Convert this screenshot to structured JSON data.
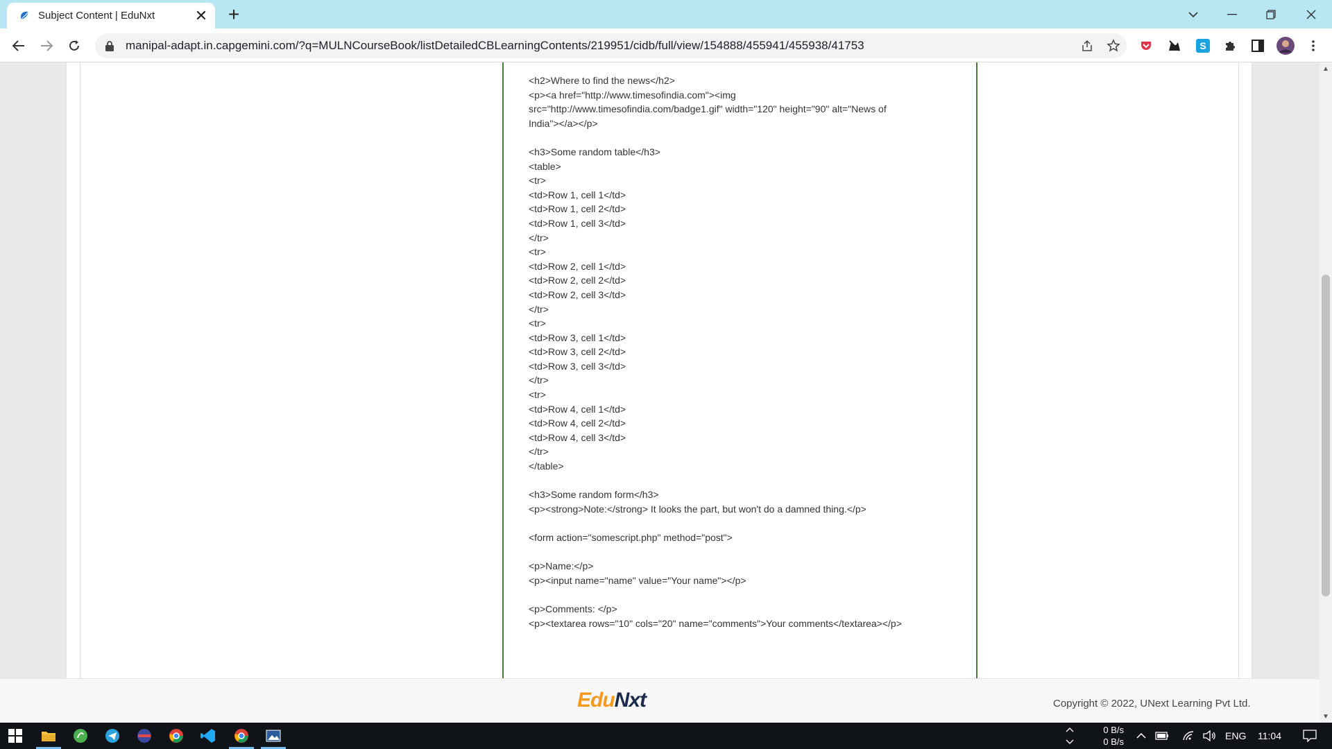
{
  "browser": {
    "tab_title": "Subject Content | EduNxt",
    "url": "manipal-adapt.in.capgemini.com/?q=MULNCourseBook/listDetailedCBLearningContents/219951/cidb/full/view/154888/455941/455938/41753"
  },
  "content": {
    "code_text": "<h2>Where to find the news</h2>\n<p><a href=\"http://www.timesofindia.com\"><img\nsrc=\"http://www.timesofindia.com/badge1.gif\" width=\"120\" height=\"90\" alt=\"News of\nIndia\"></a></p>\n\n<h3>Some random table</h3>\n<table>\n<tr>\n<td>Row 1, cell 1</td>\n<td>Row 1, cell 2</td>\n<td>Row 1, cell 3</td>\n</tr>\n<tr>\n<td>Row 2, cell 1</td>\n<td>Row 2, cell 2</td>\n<td>Row 2, cell 3</td>\n</tr>\n<tr>\n<td>Row 3, cell 1</td>\n<td>Row 3, cell 2</td>\n<td>Row 3, cell 3</td>\n</tr>\n<tr>\n<td>Row 4, cell 1</td>\n<td>Row 4, cell 2</td>\n<td>Row 4, cell 3</td>\n</tr>\n</table>\n\n<h3>Some random form</h3>\n<p><strong>Note:</strong> It looks the part, but won't do a damned thing.</p>\n\n<form action=\"somescript.php\" method=\"post\">\n\n<p>Name:</p>\n<p><input name=\"name\" value=\"Your name\"></p>\n\n<p>Comments: </p>\n<p><textarea rows=\"10\" cols=\"20\" name=\"comments\">Your comments</textarea></p>"
  },
  "footer": {
    "logo_edu": "Edu",
    "logo_nxt": "Nxt",
    "copyright": "Copyright © 2022, UNext Learning Pvt Ltd."
  },
  "taskbar": {
    "net_up": "0 B/s",
    "net_down": "0 B/s",
    "language": "ENG",
    "time": "11:04"
  },
  "colors": {
    "tabstrip": "#b8e6f2",
    "code_border": "#4a7a3a",
    "logo_orange": "#f39a1e",
    "logo_navy": "#1b2a4a",
    "taskbar": "#101418"
  }
}
